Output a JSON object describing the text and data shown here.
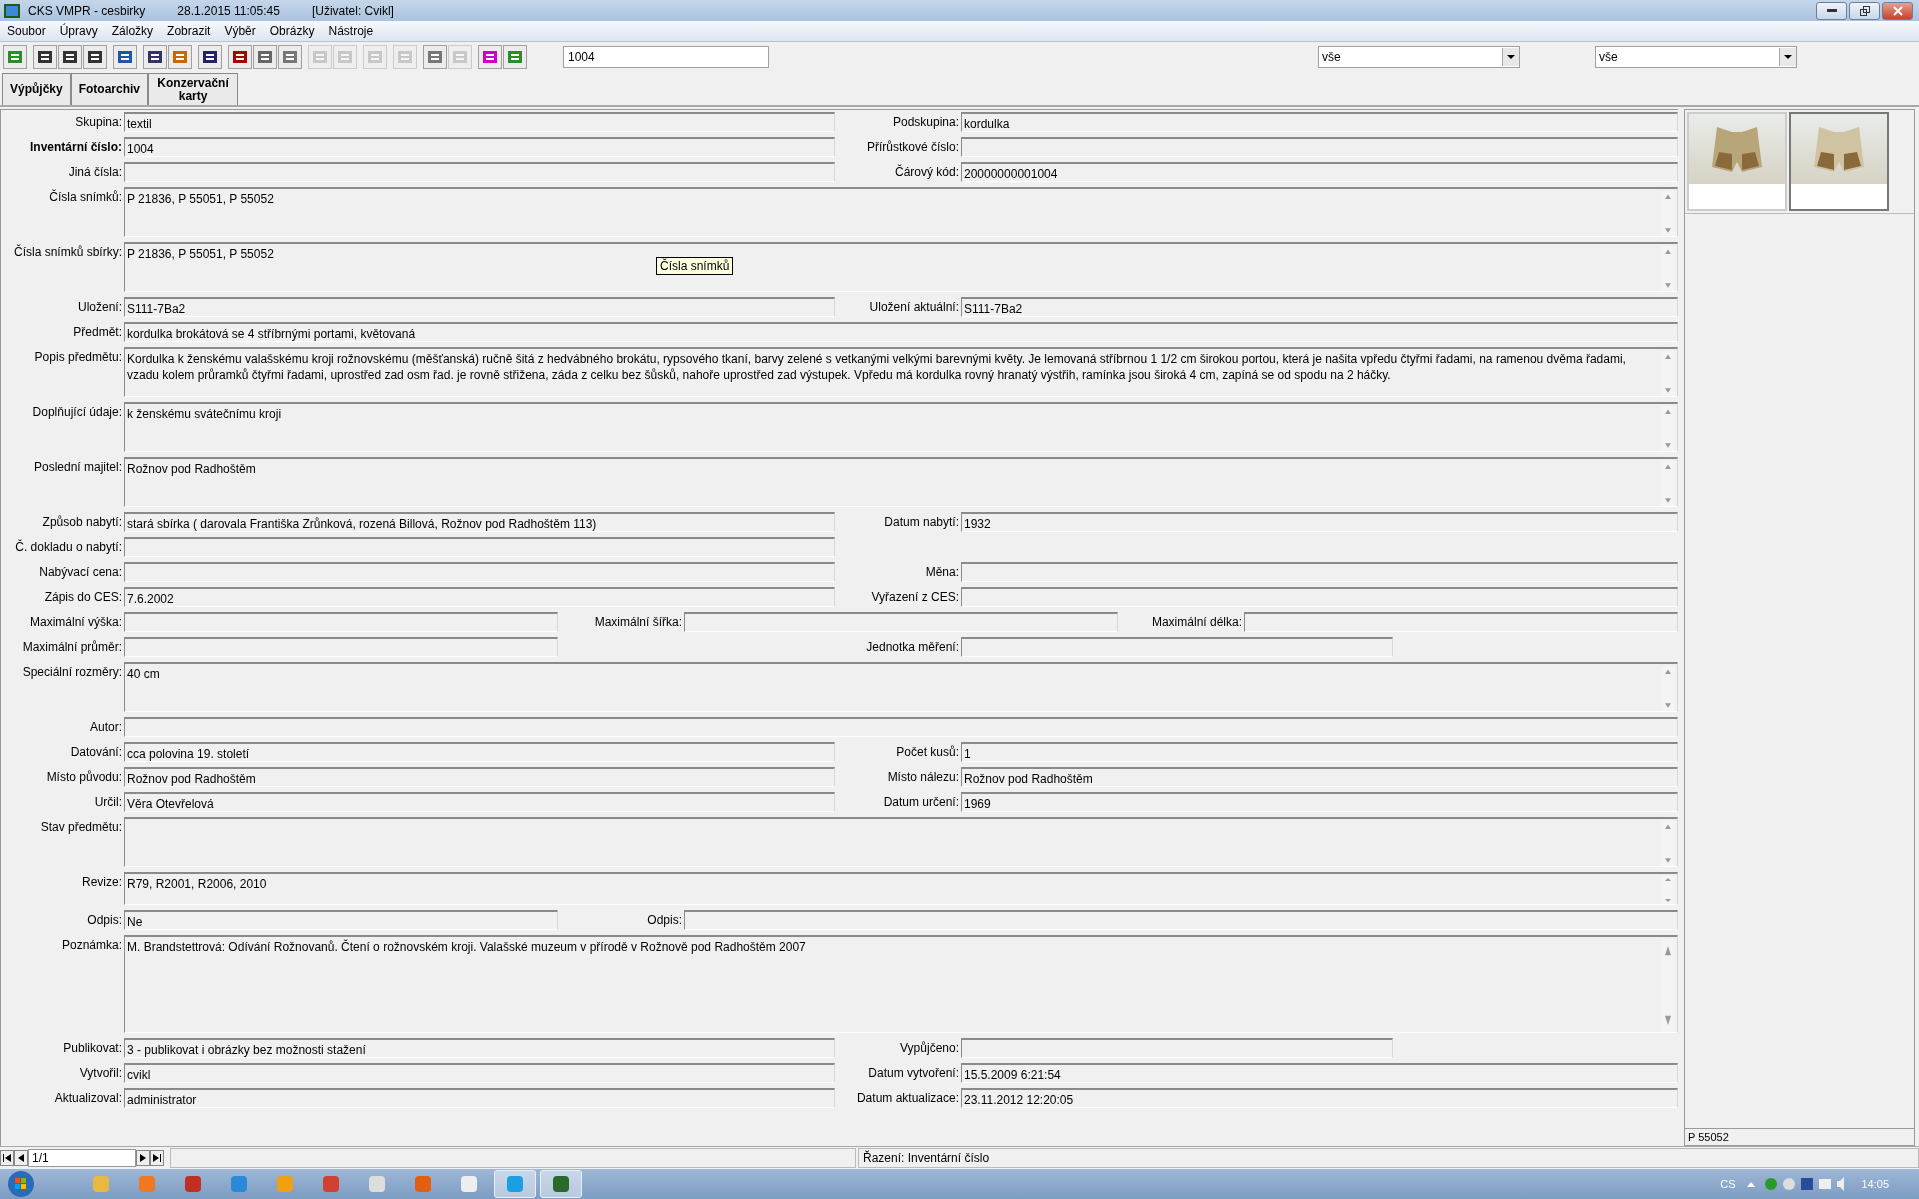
{
  "window": {
    "title": "CKS VMPR - cesbirky",
    "datetime": "28.1.2015 11:05:45",
    "user": "[Uživatel: Cvikl]"
  },
  "menu": [
    "Soubor",
    "Úpravy",
    "Záložky",
    "Zobrazit",
    "Výběr",
    "Obrázky",
    "Nástroje"
  ],
  "toolbar": {
    "groups": [
      [
        {
          "disabled": false
        }
      ],
      [
        {
          "disabled": false
        },
        {
          "disabled": false
        },
        {
          "disabled": false
        }
      ],
      [
        {
          "disabled": false
        }
      ],
      [
        {
          "disabled": false
        },
        {
          "disabled": false
        }
      ],
      [
        {
          "disabled": false
        }
      ],
      [
        {
          "disabled": false
        },
        {
          "disabled": false
        },
        {
          "disabled": false
        }
      ],
      [
        {
          "disabled": true
        },
        {
          "disabled": true
        }
      ],
      [
        {
          "disabled": true
        }
      ],
      [
        {
          "disabled": true
        }
      ],
      [
        {
          "disabled": false
        },
        {
          "disabled": true
        }
      ],
      [
        {
          "disabled": false
        },
        {
          "disabled": false
        }
      ]
    ],
    "search_value": "1004",
    "filters": [
      {
        "value": "vše"
      },
      {
        "value": "vše"
      }
    ]
  },
  "tabs": [
    {
      "label": "Výpůjčky"
    },
    {
      "label": "Fotoarchiv"
    },
    {
      "label": "Konzervační karty"
    }
  ],
  "form": [
    {
      "kind": "pair",
      "fields": [
        {
          "label": "Skupina:",
          "value": "textil",
          "bold": false
        },
        {
          "label": "Podskupina:",
          "value": "kordulka",
          "bold": false
        }
      ]
    },
    {
      "kind": "pair",
      "fields": [
        {
          "label": "Inventární číslo:",
          "value": "1004",
          "bold": true
        },
        {
          "label": "Přírůstkové číslo:",
          "bold": false
        }
      ]
    },
    {
      "kind": "pair",
      "fields": [
        {
          "label": "Jiná čísla:",
          "bold": false
        },
        {
          "label": "Čárový kód:",
          "value": "20000000001004",
          "bold": false
        }
      ]
    },
    {
      "kind": "area",
      "fields": [
        {
          "label": "Čísla snímků:",
          "value": "P 21836, P 55051, P 55052",
          "bold": false
        }
      ]
    },
    {
      "kind": "area",
      "tooltip": "Čísla snímků",
      "fields": [
        {
          "label": "Čísla snímků sbírky:",
          "value": "P 21836, P 55051, P 55052",
          "bold": false
        }
      ]
    },
    {
      "kind": "pair",
      "fields": [
        {
          "label": "Uložení:",
          "value": "S111-7Ba2",
          "bold": false
        },
        {
          "label": "Uložení aktuální:",
          "value": "S111-7Ba2",
          "bold": false
        }
      ]
    },
    {
      "kind": "single",
      "fields": [
        {
          "label": "Předmět:",
          "value": "kordulka brokátová se 4 stříbrnými portami, květovaná",
          "bold": false
        }
      ]
    },
    {
      "kind": "area",
      "fields": [
        {
          "label": "Popis předmětu:",
          "value": "Kordulka k ženskému valašskému kroji rožnovskému (měšťanská) ručně šitá z hedvábného brokátu, rypsového tkaní, barvy zelené s vetkanými velkými barevnými květy. Je lemovaná stříbrnou 1 1/2 cm širokou portou, která je našita vpředu čtyřmi řadami, na ramenou dvěma řadami, vzadu kolem průramků čtyřmi řadami, uprostřed zad osm řad. je rovně střižena, záda z celku bez šůsků, nahoře uprostřed zad výstupek. Vpředu má kordulka rovný hranatý výstřih, ramínka jsou široká 4 cm, zapíná se od spodu na 2 háčky.",
          "bold": false
        }
      ]
    },
    {
      "kind": "area",
      "fields": [
        {
          "label": "Doplňující údaje:",
          "value": "k ženskému svátečnímu kroji",
          "bold": false
        }
      ]
    },
    {
      "kind": "area",
      "fields": [
        {
          "label": "Poslední majitel:",
          "value": "Rožnov pod Radhoštěm",
          "bold": false
        }
      ]
    },
    {
      "kind": "pair",
      "fields": [
        {
          "label": "Způsob nabytí:",
          "value": "stará sbírka ( darovala Františka Zrůnková, rozená Billová, Rožnov pod Radhoštěm 113)",
          "bold": false
        },
        {
          "label": "Datum nabytí:",
          "value": "1932",
          "bold": false
        }
      ]
    },
    {
      "kind": "pair",
      "fields": [
        {
          "label": "Č. dokladu o nabytí:",
          "bold": false
        }
      ]
    },
    {
      "kind": "pair",
      "fields": [
        {
          "label": "Nabývací cena:",
          "bold": false
        },
        {
          "label": "Měna:",
          "bold": false
        }
      ]
    },
    {
      "kind": "pair",
      "fields": [
        {
          "label": "Zápis do CES:",
          "value": "7.6.2002",
          "bold": false
        },
        {
          "label": "Vyřazení z CES:",
          "bold": false
        }
      ]
    },
    {
      "kind": "triple",
      "fields": [
        {
          "label": "Maximální výška:",
          "bold": false
        },
        {
          "label": "Maximální šířka:",
          "bold": false
        },
        {
          "label": "Maximální délka:",
          "bold": false
        }
      ]
    },
    {
      "kind": "short_pair",
      "fields": [
        {
          "label": "Maximální průměr:",
          "bold": false
        },
        {
          "label": "Jednotka měření:",
          "bold": false
        }
      ]
    },
    {
      "kind": "area",
      "fields": [
        {
          "label": "Speciální rozměry:",
          "value": "40 cm",
          "bold": false
        }
      ]
    },
    {
      "kind": "single",
      "fields": [
        {
          "label": "Autor:",
          "bold": false
        }
      ]
    },
    {
      "kind": "pair",
      "fields": [
        {
          "label": "Datování:",
          "value": "cca polovina 19. století",
          "bold": false
        },
        {
          "label": "Počet kusů:",
          "value": "1",
          "bold": false
        }
      ]
    },
    {
      "kind": "pair",
      "fields": [
        {
          "label": "Místo původu:",
          "value": "Rožnov pod Radhoštěm",
          "bold": false
        },
        {
          "label": "Místo nálezu:",
          "value": "Rožnov pod Radhoštěm",
          "bold": false
        }
      ]
    },
    {
      "kind": "pair",
      "fields": [
        {
          "label": "Určil:",
          "value": "Věra Otevřelová",
          "bold": false
        },
        {
          "label": "Datum určení:",
          "value": "1969",
          "bold": false
        }
      ]
    },
    {
      "kind": "area",
      "fields": [
        {
          "label": "Stav předmětu:",
          "bold": false
        }
      ]
    },
    {
      "kind": "area_short",
      "fields": [
        {
          "label": "Revize:",
          "value": "R79, R2001, R2006, 2010",
          "bold": false
        }
      ]
    },
    {
      "kind": "short_wide",
      "fields": [
        {
          "label": "Odpis:",
          "value": "Ne",
          "bold": false
        },
        {
          "label": "Odpis:",
          "bold": false
        }
      ]
    },
    {
      "kind": "area_tall",
      "fields": [
        {
          "label": "Poznámka:",
          "value": "M. Brandstettrová: Odívání Rožnovanů. Čtení o rožnovském kroji. Valašské muzeum v přírodě v Rožnově pod Radhoštěm 2007",
          "bold": false
        }
      ]
    },
    {
      "kind": "pair_short",
      "fields": [
        {
          "label": "Publikovat:",
          "value": "3 - publikovat i obrázky bez možnosti stažení",
          "bold": false
        },
        {
          "label": "Vypůjčeno:",
          "bold": false
        }
      ]
    },
    {
      "kind": "pair",
      "fields": [
        {
          "label": "Vytvořil:",
          "value": "cvikl",
          "bold": false
        },
        {
          "label": "Datum vytvoření:",
          "value": "15.5.2009 6:21:54",
          "bold": false
        }
      ]
    },
    {
      "kind": "pair",
      "fields": [
        {
          "label": "Aktualizoval:",
          "value": "administrator",
          "bold": false
        },
        {
          "label": "Datum aktualizace:",
          "value": "23.11.2012 12:20:05",
          "bold": false
        }
      ]
    }
  ],
  "images": {
    "thumbnails": [
      {
        "selected": false
      },
      {
        "selected": true
      }
    ],
    "caption": "P 55052"
  },
  "status_bar": {
    "record": "1/1",
    "sorting": "Řazení: Inventární číslo"
  },
  "taskbar": {
    "apps": [
      {
        "active": false
      },
      {
        "active": false
      },
      {
        "active": false
      },
      {
        "active": false
      },
      {
        "active": false
      },
      {
        "active": false
      },
      {
        "active": false
      },
      {
        "active": false
      },
      {
        "active": false
      },
      {
        "active": true
      },
      {
        "active": true
      }
    ],
    "language": "CS",
    "clock": "14:05"
  }
}
